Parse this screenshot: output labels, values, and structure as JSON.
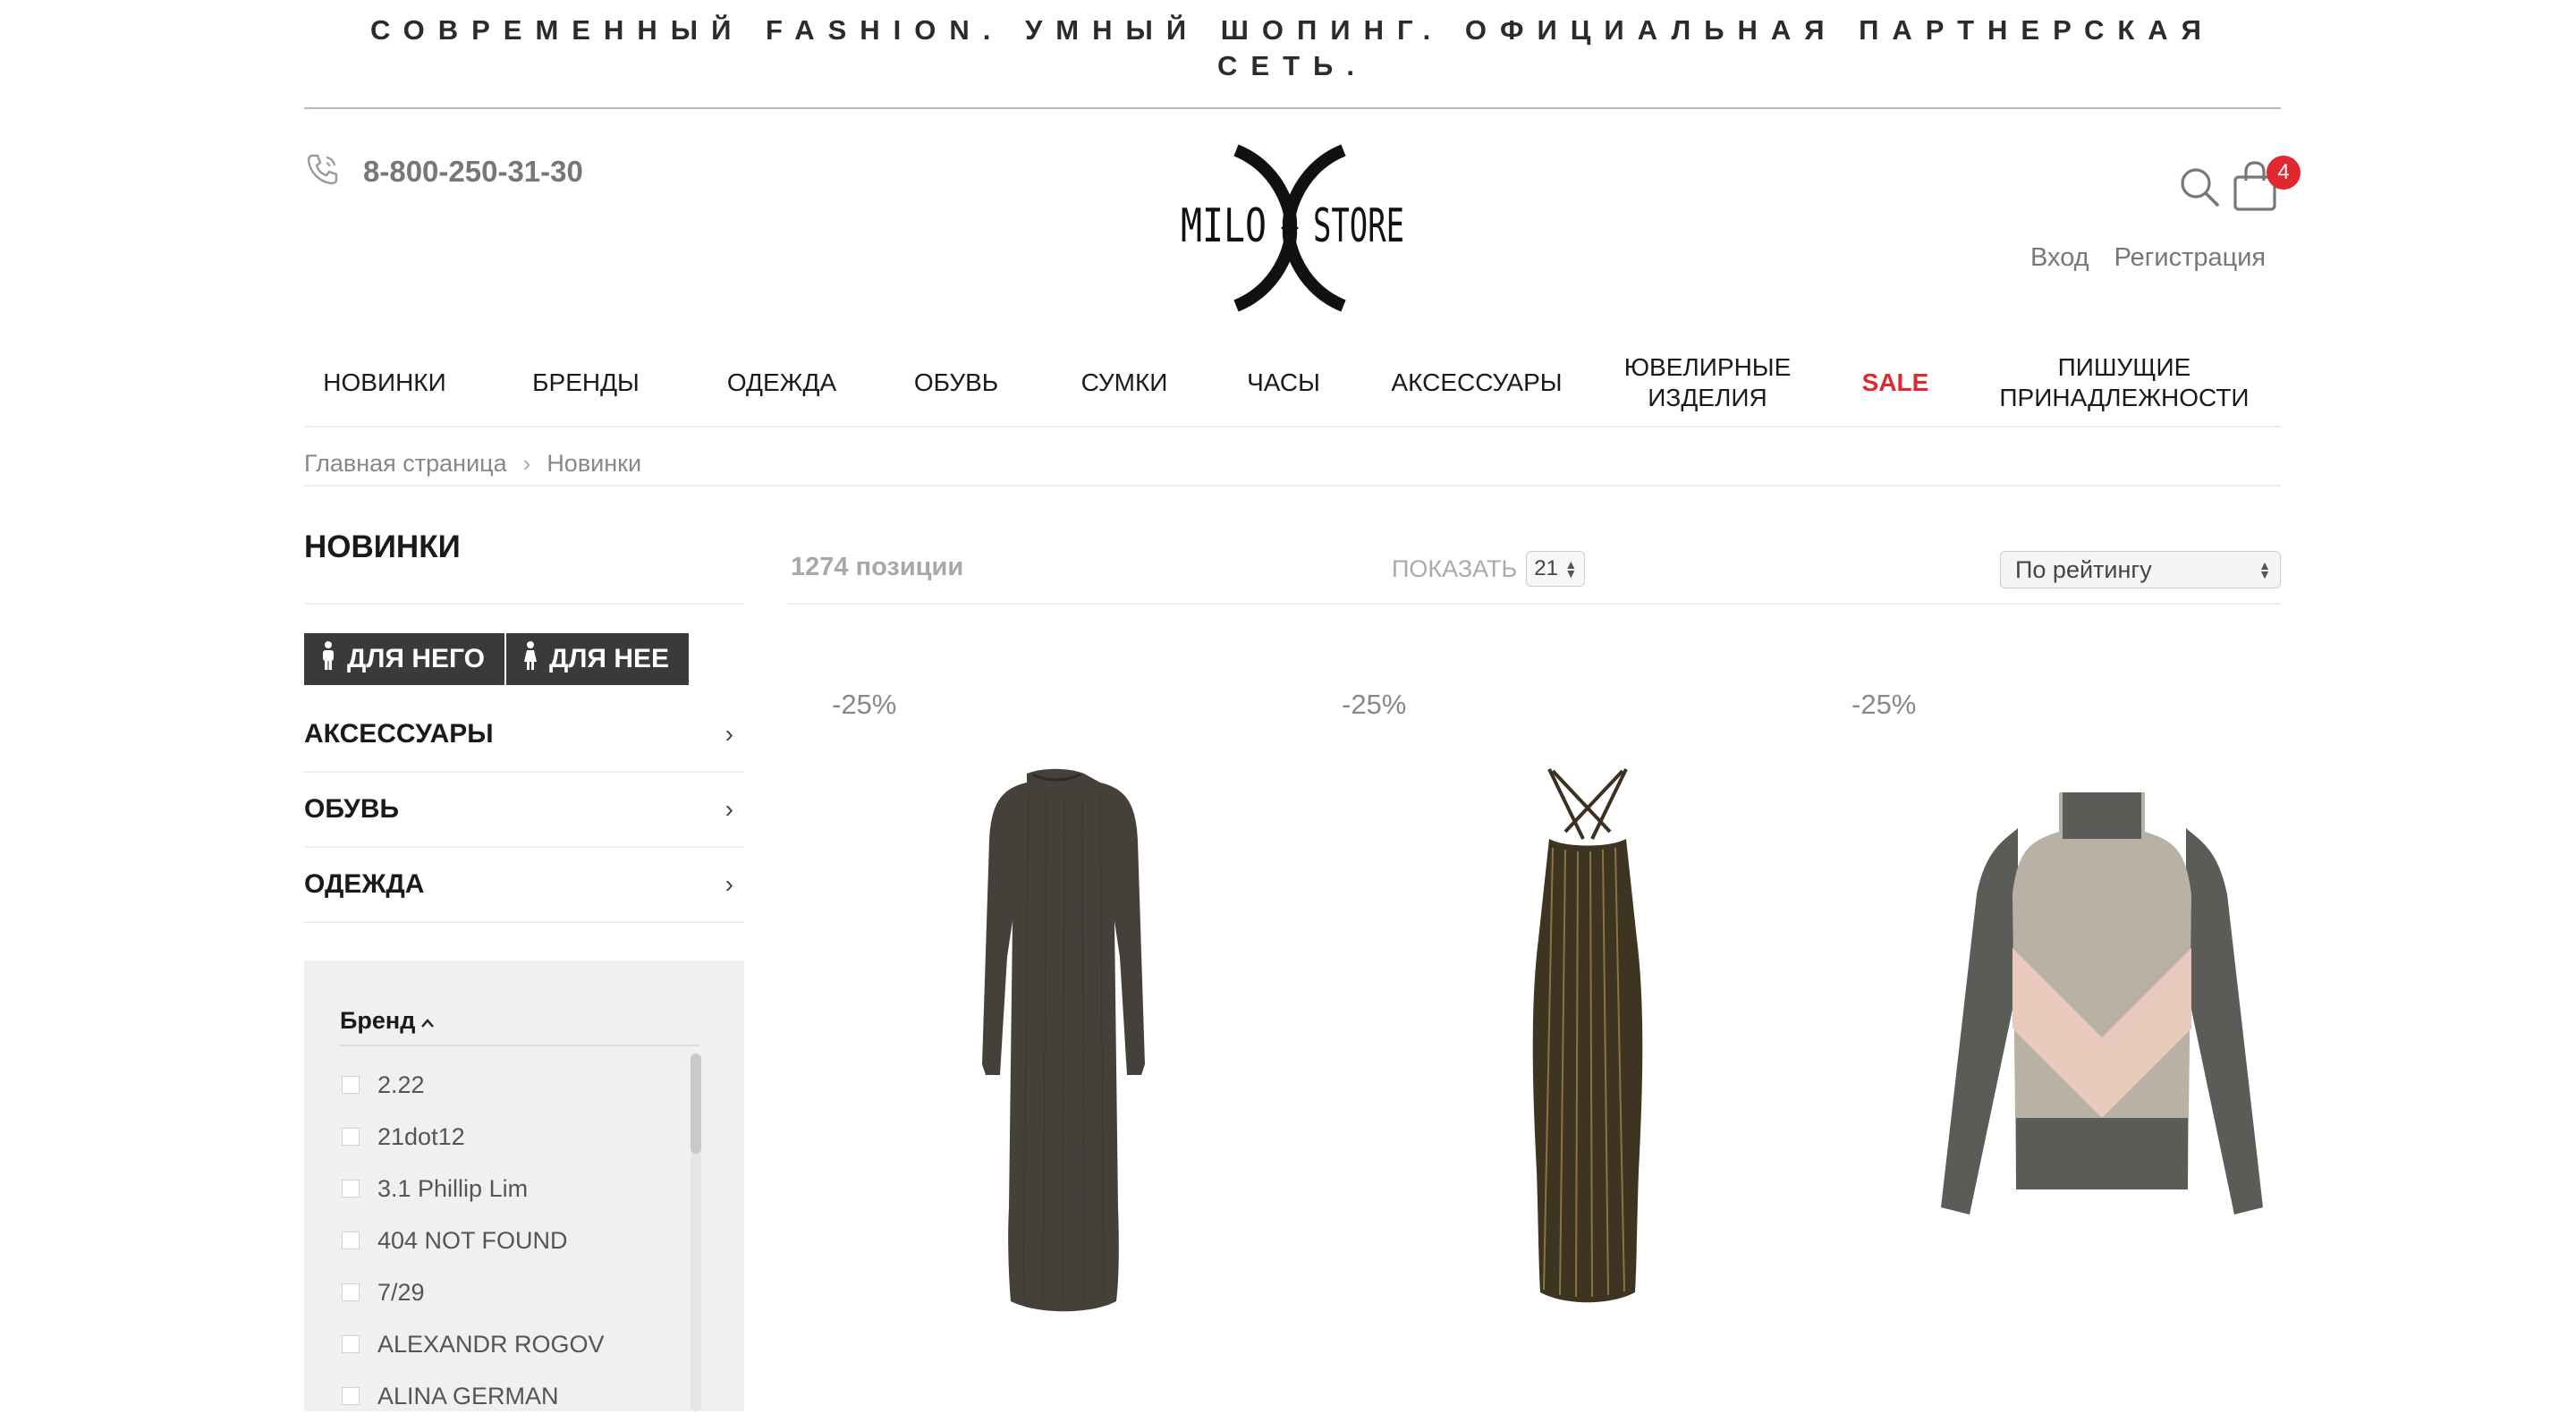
{
  "banner": "СОВРЕМЕННЫЙ FASHION. УМНЫЙ ШОПИНГ. ОФИЦИАЛЬНАЯ ПАРТНЕРСКАЯ СЕТЬ.",
  "header": {
    "phone": "8-800-250-31-30",
    "logo_left": "MILO",
    "logo_right": "STORE",
    "cart_count": "4",
    "login": "Вход",
    "register": "Регистрация"
  },
  "nav": {
    "items": [
      {
        "label": "НОВИНКИ"
      },
      {
        "label": "БРЕНДЫ"
      },
      {
        "label": "ОДЕЖДА"
      },
      {
        "label": "ОБУВЬ"
      },
      {
        "label": "СУМКИ"
      },
      {
        "label": "ЧАСЫ"
      },
      {
        "label": "АКСЕССУАРЫ"
      },
      {
        "label": "ЮВЕЛИРНЫЕ\nИЗДЕЛИЯ"
      },
      {
        "label": "SALE"
      },
      {
        "label": "ПИШУЩИЕ\nПРИНАДЛЕЖНОСТИ"
      }
    ],
    "sale_color": "#e0282e"
  },
  "breadcrumb": {
    "home": "Главная страница",
    "current": "Новинки"
  },
  "page_title": "НОВИНКИ",
  "toolbar": {
    "count": "1274 позиции",
    "show_label": "ПОКАЗАТЬ",
    "show_value": "21",
    "sort_value": "По рейтингу"
  },
  "gender": {
    "him": "ДЛЯ НЕГО",
    "her": "ДЛЯ НЕЕ"
  },
  "categories": [
    {
      "label": "АКСЕССУАРЫ"
    },
    {
      "label": "ОБУВЬ"
    },
    {
      "label": "ОДЕЖДА"
    }
  ],
  "filter": {
    "title": "Бренд",
    "brands": [
      "2.22",
      "21dot12",
      "3.1 Phillip Lim",
      "404 NOT FOUND",
      "7/29",
      "ALEXANDR ROGOV",
      "ALINA GERMAN"
    ]
  },
  "products": [
    {
      "discount": "-25%",
      "image": "dark-olive-knit-midi-dress"
    },
    {
      "discount": "-25%",
      "image": "ribbed-lurex-strappy-dress"
    },
    {
      "discount": "-25%",
      "image": "turtleneck-chevron-sweater"
    }
  ]
}
